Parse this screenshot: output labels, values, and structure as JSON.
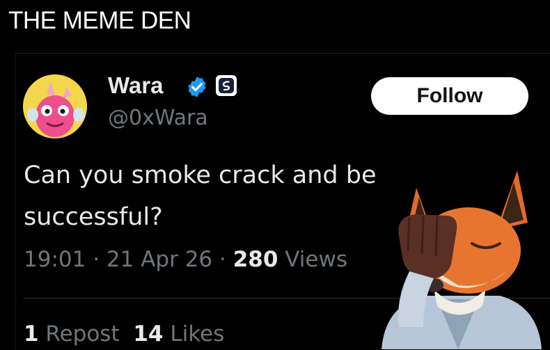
{
  "page": {
    "brand": "THE MEME DEN"
  },
  "tweet": {
    "author_name": "Wara",
    "handle": "@0xWara",
    "follow_label": "Follow",
    "text": "Can you smoke crack and be successful?",
    "time": "19:01",
    "sep1": " · ",
    "date": "21 Apr 26",
    "sep2": " · ",
    "views_count": "280",
    "views_label": " Views",
    "reposts_count": "1",
    "reposts_label": " Repost",
    "likes_count": "14",
    "likes_label": " Likes"
  },
  "colors": {
    "background": "#000000",
    "text_primary": "#e7e9ea",
    "text_secondary": "#71767b",
    "verified": "#1d9bf0",
    "avatar_bg": "#f4d64c"
  },
  "icons": {
    "verified": "verified-check-icon",
    "affiliate": "affiliate-badge-icon",
    "avatar": "pink-monster-avatar",
    "sticker": "facepalm-fox-sticker"
  }
}
